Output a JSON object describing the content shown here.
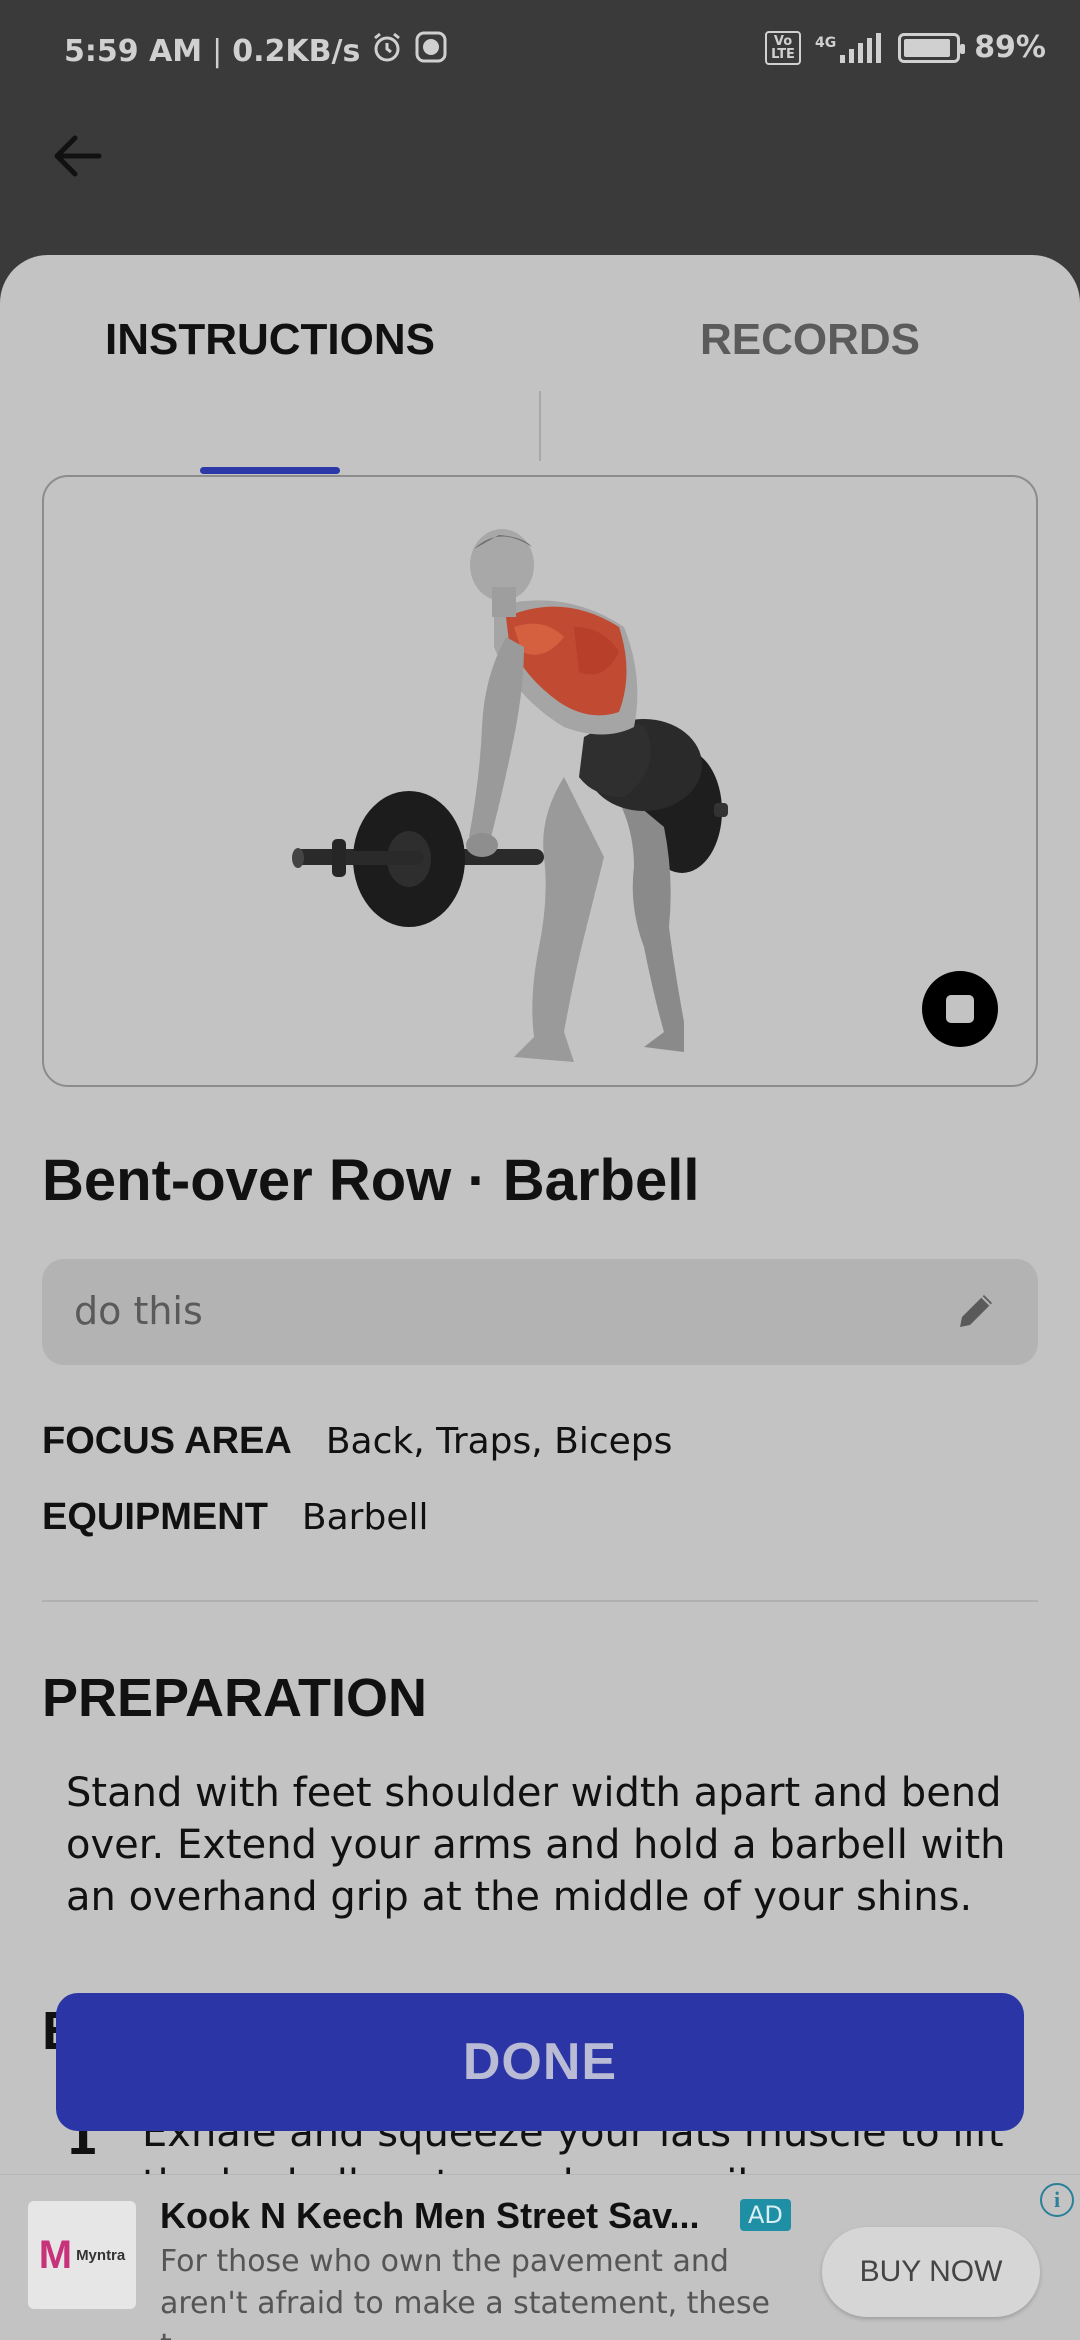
{
  "status_bar": {
    "time": "5:59 AM",
    "separator": "|",
    "net_speed": "0.2KB/s",
    "volte": "Vo\nLTE",
    "network": "4G",
    "battery_pct": "89%",
    "battery_level": 0.89,
    "icons": [
      "alarm-icon",
      "app-notification-icon",
      "signal-icon",
      "battery-icon"
    ]
  },
  "header": {
    "back_icon": "arrow-left-icon"
  },
  "tabs": [
    {
      "label": "INSTRUCTIONS",
      "active": true
    },
    {
      "label": "RECORDS",
      "active": false
    }
  ],
  "colors": {
    "accent": "#2b38a8",
    "done_button": "#2b35a6",
    "ad_badge": "#1f8fa6",
    "muscle_highlight": "#c04a32"
  },
  "exercise": {
    "title": "Bent-over Row · Barbell",
    "note_value": "do this",
    "focus_area_label": "FOCUS AREA",
    "focus_area_value": "Back, Traps, Biceps",
    "equipment_label": "EQUIPMENT",
    "equipment_value": "Barbell",
    "preparation_title": "PREPARATION",
    "preparation_text": "Stand with feet shoulder width apart and bend over. Extend your arms and hold a barbell with an overhand grip at the middle of your shins.",
    "execution_title_partial": "E",
    "step_number": "1",
    "step_text": "Exhale and squeeze your lats muscle to lift the barbell up towards your rib cage."
  },
  "done_label": "DONE",
  "ad": {
    "logo_text": "Myntra",
    "title": "Kook N Keech Men Street Sav...",
    "badge": "AD",
    "description": "For those who own the pavement and aren't afraid to make a statement, these t...",
    "cta": "BUY NOW",
    "info": "i"
  }
}
